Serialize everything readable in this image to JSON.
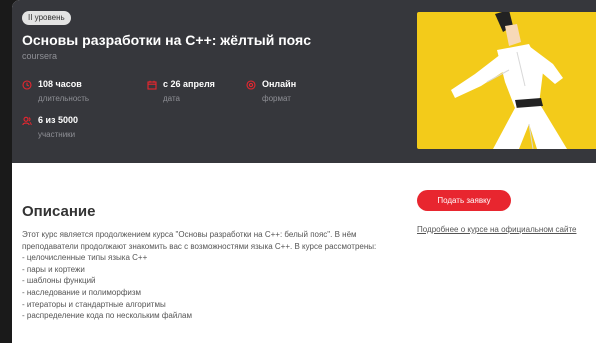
{
  "hero": {
    "level_badge": "II уровень",
    "title": "Основы разработки на C++: жёлтый пояс",
    "provider": "coursera",
    "stats": [
      {
        "icon": "clock-icon",
        "value": "108 часов",
        "label": "длительность"
      },
      {
        "icon": "calendar-icon",
        "value": "с 26 апреля",
        "label": "дата"
      },
      {
        "icon": "globe-icon",
        "value": "Онлайн",
        "label": "формат"
      },
      {
        "icon": "users-icon",
        "value": "6 из 5000",
        "label": "участники"
      }
    ],
    "image": "karate-figure-illustration"
  },
  "description": {
    "heading": "Описание",
    "intro": "Этот курс является продолжением курса \"Основы разработки на C++: белый пояс\". В нём преподаватели продолжают знакомить вас с возможностями языка C++. В курсе рассмотрены:",
    "items": [
      "- целочисленные типы языка C++",
      "- пары и кортежи",
      "- шаблоны функций",
      "- наследование и полиморфизм",
      "- итераторы и стандартные алгоритмы",
      "- распределение кода по нескольким файлам"
    ]
  },
  "sidebar": {
    "apply_label": "Подать заявку",
    "official_link": "Подробнее о курсе на официальном сайте"
  },
  "colors": {
    "hero_bg": "#36373c",
    "accent_red": "#e8262f",
    "image_yellow": "#f3cb1a"
  }
}
